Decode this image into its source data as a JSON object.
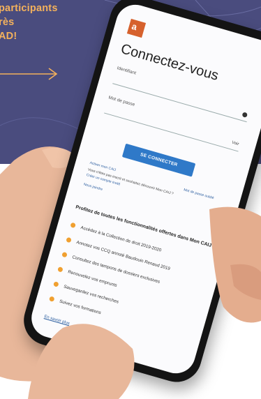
{
  "promo": {
    "line1": "participants",
    "line2": "rès",
    "line3": "AD!"
  },
  "colors": {
    "banner": "#4a4c7e",
    "accent": "#f3b15c",
    "button": "#2f79c8",
    "bullet": "#f0a030"
  },
  "phone": {
    "logo_letter": "a",
    "title": "Connectez-vous",
    "identifier_label": "Identifiant",
    "password_label": "Mot de passe",
    "show_label": "Voir",
    "login_button": "SE CONNECTER",
    "link_left": "Activer mon CAIJ",
    "link_right": "Mot de passe oublié",
    "info_text": "Vous n'êtes pas inscrit et souhaitez découvrir Mon CAIJ ?",
    "info_link": "Créer un compte invité",
    "more_info": "Nous joindre",
    "features_title": "Profitez de toutes les fonctionnalités offertes dans Mon CAIJ",
    "features": [
      "Accédez à la Collection de droit 2019-2020",
      "Annotez vos CCQ annoté Baudouin Renaud 2019",
      "Consultez des tampons de dossiers exclusives",
      "Renouvelez vos emprunts",
      "Sauvegardez vos recherches",
      "Suivez vos formations"
    ],
    "learn_more": "En savoir plus"
  }
}
